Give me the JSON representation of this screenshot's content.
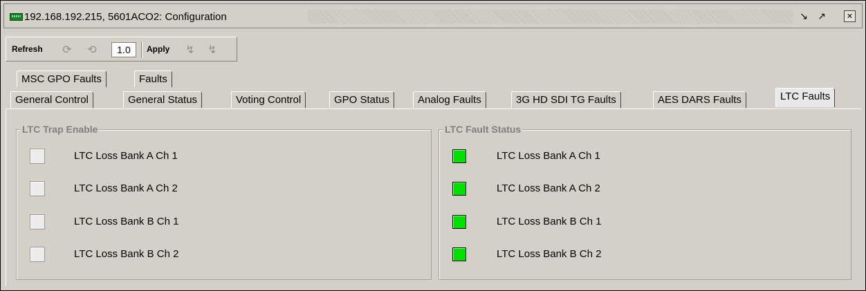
{
  "window": {
    "title": "192.168.192.215, 5601ACO2: Configuration",
    "icons": [
      "device-icon",
      "dock-icon",
      "undock-icon",
      "close-icon"
    ]
  },
  "toolbar": {
    "refresh_label": "Refresh",
    "zoom_value": "1.0",
    "apply_label": "Apply"
  },
  "tabs_row1": [
    {
      "label": "MSC GPO Faults"
    },
    {
      "label": "Faults"
    }
  ],
  "tabs_row2": [
    {
      "label": "General Control"
    },
    {
      "label": "General Status"
    },
    {
      "label": "Voting Control"
    },
    {
      "label": "GPO Status"
    },
    {
      "label": "Analog Faults"
    },
    {
      "label": "3G HD SDI TG Faults"
    },
    {
      "label": "AES DARS Faults"
    },
    {
      "label": "LTC Faults",
      "active": true
    }
  ],
  "trap_enable": {
    "title": "LTC Trap Enable",
    "items": [
      {
        "label": "LTC Loss Bank A Ch 1",
        "checked": false
      },
      {
        "label": "LTC Loss Bank A Ch 2",
        "checked": false
      },
      {
        "label": "LTC Loss Bank B Ch 1",
        "checked": false
      },
      {
        "label": "LTC Loss Bank B Ch 2",
        "checked": false
      }
    ]
  },
  "fault_status": {
    "title": "LTC Fault Status",
    "ok_color": "#00e000",
    "items": [
      {
        "label": "LTC Loss Bank A Ch 1",
        "status": "ok"
      },
      {
        "label": "LTC Loss Bank A Ch 2",
        "status": "ok"
      },
      {
        "label": "LTC Loss Bank B Ch 1",
        "status": "ok"
      },
      {
        "label": "LTC Loss Bank B Ch 2",
        "status": "ok"
      }
    ]
  }
}
